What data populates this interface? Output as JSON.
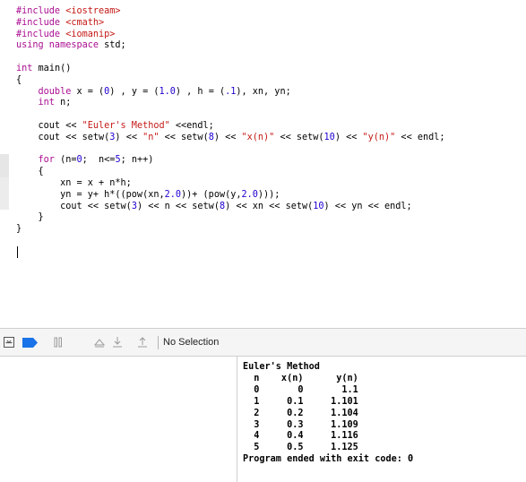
{
  "editor": {
    "lines": [
      [
        {
          "t": "#include ",
          "c": "kw"
        },
        {
          "t": "<iostream>",
          "c": "str"
        }
      ],
      [
        {
          "t": "#include ",
          "c": "kw"
        },
        {
          "t": "<cmath>",
          "c": "str"
        }
      ],
      [
        {
          "t": "#include ",
          "c": "kw"
        },
        {
          "t": "<iomanip>",
          "c": "str"
        }
      ],
      [
        {
          "t": "using namespace ",
          "c": "kw"
        },
        {
          "t": "std;",
          "c": "id"
        }
      ],
      [],
      [
        {
          "t": "int ",
          "c": "kw"
        },
        {
          "t": "main()",
          "c": "id"
        }
      ],
      [
        {
          "t": "{",
          "c": "id"
        }
      ],
      [
        {
          "t": "    double ",
          "c": "kw"
        },
        {
          "t": "x = (",
          "c": "id"
        },
        {
          "t": "0",
          "c": "num"
        },
        {
          "t": ") , y = (",
          "c": "id"
        },
        {
          "t": "1.0",
          "c": "num"
        },
        {
          "t": ") , h = (",
          "c": "id"
        },
        {
          "t": ".1",
          "c": "num"
        },
        {
          "t": "), xn, yn;",
          "c": "id"
        }
      ],
      [
        {
          "t": "    int ",
          "c": "kw"
        },
        {
          "t": "n;",
          "c": "id"
        }
      ],
      [],
      [
        {
          "t": "    cout << ",
          "c": "id"
        },
        {
          "t": "\"Euler's Method\"",
          "c": "str"
        },
        {
          "t": " <<endl;",
          "c": "id"
        }
      ],
      [
        {
          "t": "    cout << setw(",
          "c": "id"
        },
        {
          "t": "3",
          "c": "num"
        },
        {
          "t": ") << ",
          "c": "id"
        },
        {
          "t": "\"n\"",
          "c": "str"
        },
        {
          "t": " << setw(",
          "c": "id"
        },
        {
          "t": "8",
          "c": "num"
        },
        {
          "t": ") << ",
          "c": "id"
        },
        {
          "t": "\"x(n)\"",
          "c": "str"
        },
        {
          "t": " << setw(",
          "c": "id"
        },
        {
          "t": "10",
          "c": "num"
        },
        {
          "t": ") << ",
          "c": "id"
        },
        {
          "t": "\"y(n)\"",
          "c": "str"
        },
        {
          "t": " << endl;",
          "c": "id"
        }
      ],
      [],
      [
        {
          "t": "    for ",
          "c": "kw"
        },
        {
          "t": "(n=",
          "c": "id"
        },
        {
          "t": "0",
          "c": "num"
        },
        {
          "t": ";  n<=",
          "c": "id"
        },
        {
          "t": "5",
          "c": "num"
        },
        {
          "t": "; n++)",
          "c": "id"
        }
      ],
      [
        {
          "t": "    {",
          "c": "id"
        }
      ],
      [
        {
          "t": "        xn = x + n*h;",
          "c": "id"
        }
      ],
      [
        {
          "t": "        yn = y+ h*((pow(xn,",
          "c": "id"
        },
        {
          "t": "2.0",
          "c": "num"
        },
        {
          "t": "))+ (pow(y,",
          "c": "id"
        },
        {
          "t": "2.0",
          "c": "num"
        },
        {
          "t": ")));",
          "c": "id"
        }
      ],
      [
        {
          "t": "        cout << setw(",
          "c": "id"
        },
        {
          "t": "3",
          "c": "num"
        },
        {
          "t": ") << n << setw(",
          "c": "id"
        },
        {
          "t": "8",
          "c": "num"
        },
        {
          "t": ") << xn << setw(",
          "c": "id"
        },
        {
          "t": "10",
          "c": "num"
        },
        {
          "t": ") << yn << endl;",
          "c": "id"
        }
      ],
      [
        {
          "t": "    }",
          "c": "id"
        }
      ],
      [
        {
          "t": "}",
          "c": "id"
        }
      ]
    ]
  },
  "debug_bar": {
    "selection_label": "No Selection"
  },
  "console": {
    "lines": [
      "Euler's Method",
      "  n    x(n)      y(n)",
      "  0       0       1.1",
      "  1     0.1     1.101",
      "  2     0.2     1.104",
      "  3     0.3     1.109",
      "  4     0.4     1.116",
      "  5     0.5     1.125",
      "Program ended with exit code: 0"
    ]
  },
  "colors": {
    "keyword": "#aa0d91",
    "string": "#c41a16",
    "number": "#1c00cf",
    "breakpoint_arrow": "#1a73e8"
  },
  "icons": [
    "hide-debug-area-icon",
    "breakpoints-toggle-icon",
    "pause-icon",
    "step-over-icon",
    "step-into-icon",
    "step-out-icon"
  ]
}
